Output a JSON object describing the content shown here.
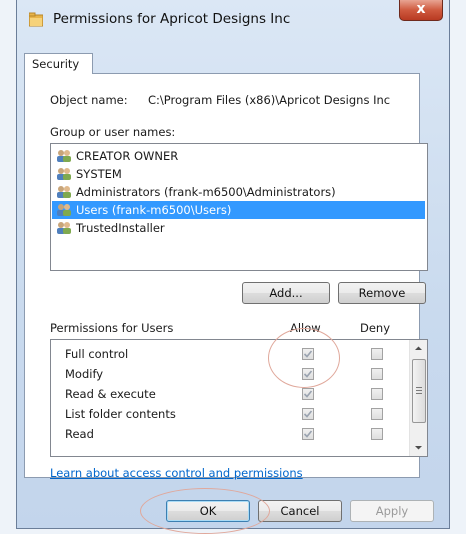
{
  "window": {
    "title": "Permissions for Apricot Designs Inc",
    "close_label": "x"
  },
  "tabs": [
    {
      "label": "Security"
    }
  ],
  "object": {
    "label": "Object name:",
    "value": "C:\\Program Files (x86)\\Apricot Designs Inc"
  },
  "group": {
    "label": "Group or user names:",
    "users": [
      {
        "name": "CREATOR OWNER",
        "selected": false
      },
      {
        "name": "SYSTEM",
        "selected": false
      },
      {
        "name": "Administrators (frank-m6500\\Administrators)",
        "selected": false
      },
      {
        "name": "Users (frank-m6500\\Users)",
        "selected": true
      },
      {
        "name": "TrustedInstaller",
        "selected": false
      }
    ]
  },
  "buttons": {
    "add": "Add...",
    "remove": "Remove",
    "ok": "OK",
    "cancel": "Cancel",
    "apply": "Apply"
  },
  "permissions": {
    "header": "Permissions for Users",
    "allow_header": "Allow",
    "deny_header": "Deny",
    "rows": [
      {
        "name": "Full control",
        "allow": true,
        "deny": false
      },
      {
        "name": "Modify",
        "allow": true,
        "deny": false
      },
      {
        "name": "Read & execute",
        "allow": true,
        "deny": false
      },
      {
        "name": "List folder contents",
        "allow": true,
        "deny": false
      },
      {
        "name": "Read",
        "allow": true,
        "deny": false
      }
    ]
  },
  "link": {
    "label": "Learn about access control and permissions"
  },
  "colors": {
    "selection": "#3399ff",
    "link": "#0066cc",
    "close_button": "#cf5a3f"
  }
}
